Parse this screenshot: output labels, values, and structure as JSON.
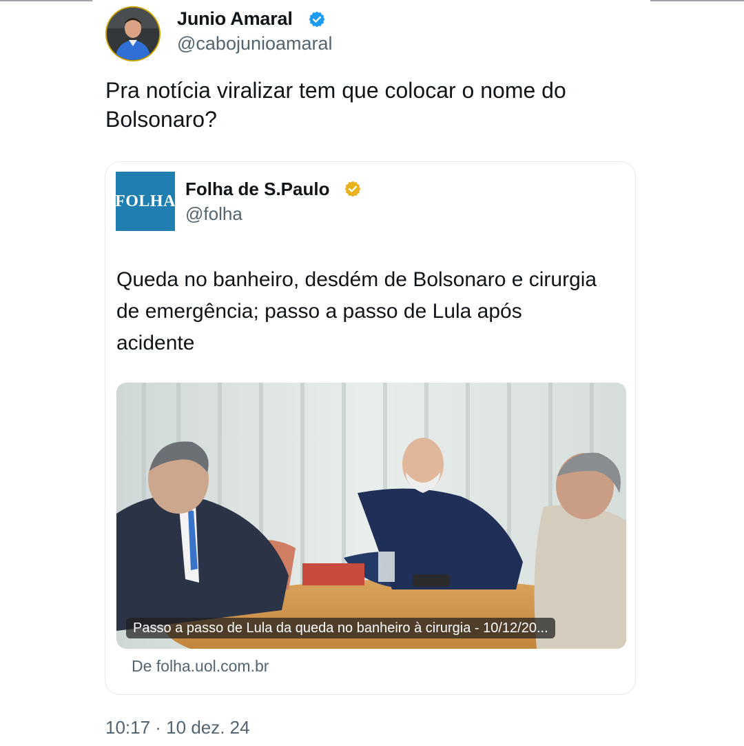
{
  "author": {
    "name": "Junio Amaral",
    "handle": "@cabojunioamaral",
    "verified_color": "#1d9bf0"
  },
  "tweet": {
    "text": "Pra notícia viralizar tem que colocar o nome do Bolsonaro?",
    "timestamp": "10:17 · 10 dez. 24"
  },
  "quoted": {
    "logo_text": "FOLHA",
    "name": "Folha de S.Paulo",
    "handle": "@folha",
    "verified_color": "#e8b21c",
    "text": "Queda no banheiro, desdém de Bolsonaro e cirurgia de emergência; passo a passo de Lula após acidente",
    "media_caption": "Passo a passo de Lula da queda no banheiro à cirurgia - 10/12/20...",
    "source": "De folha.uol.com.br"
  },
  "icons": {
    "author_badge": "verified-badge-icon",
    "quoted_badge": "verified-badge-icon"
  }
}
